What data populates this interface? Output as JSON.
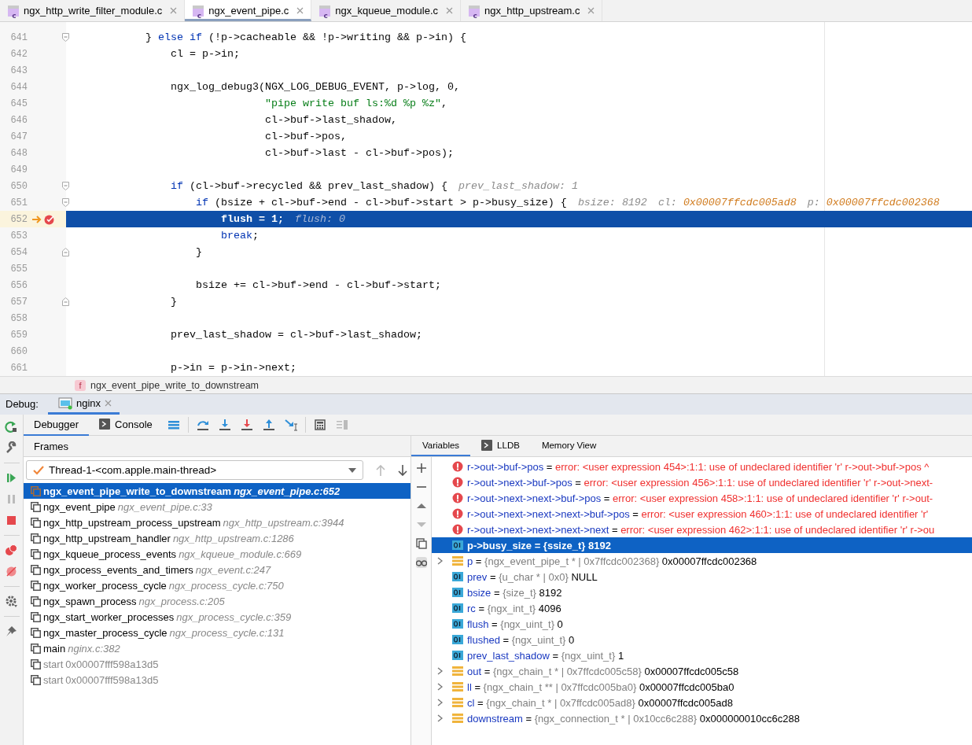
{
  "editor_tabs": [
    {
      "label": "ngx_http_write_filter_module.c",
      "file_type": "c",
      "selected": false
    },
    {
      "label": "ngx_event_pipe.c",
      "file_type": "c",
      "selected": true
    },
    {
      "label": "ngx_kqueue_module.c",
      "file_type": "c",
      "selected": false
    },
    {
      "label": "ngx_http_upstream.c",
      "file_type": "c",
      "selected": false
    }
  ],
  "editor": {
    "lines": [
      {
        "number": "641",
        "fold_open": true,
        "tokens": [
          {
            "kind": "plain",
            "text": "            } "
          },
          {
            "kind": "keyword",
            "text": "else"
          },
          {
            "kind": "keyword",
            "text": " if"
          },
          {
            "kind": "plain",
            "text": " (!p->cacheable && !p->writing && p->in) {"
          }
        ]
      },
      {
        "number": "642",
        "tokens": [
          {
            "kind": "plain",
            "text": "                cl = p->in;"
          }
        ]
      },
      {
        "number": "643"
      },
      {
        "number": "644",
        "tokens": [
          {
            "kind": "plain",
            "text": "                ngx_log_debug3(NGX_LOG_DEBUG_EVENT, p->log, 0,"
          }
        ]
      },
      {
        "number": "645",
        "tokens": [
          {
            "kind": "string",
            "text": "                               \"pipe write buf ls:%d %p %z\""
          },
          {
            "kind": "plain",
            "text": ","
          }
        ]
      },
      {
        "number": "646",
        "tokens": [
          {
            "kind": "plain",
            "text": "                               cl->buf->last_shadow,"
          }
        ]
      },
      {
        "number": "647",
        "tokens": [
          {
            "kind": "plain",
            "text": "                               cl->buf->pos,"
          }
        ]
      },
      {
        "number": "648",
        "tokens": [
          {
            "kind": "plain",
            "text": "                               cl->buf->last - cl->buf->pos);"
          }
        ]
      },
      {
        "number": "649"
      },
      {
        "number": "650",
        "fold_open": true,
        "tokens": [
          {
            "kind": "keyword",
            "text": "                if"
          },
          {
            "kind": "plain",
            "text": " (cl->buf->recycled && prev_last_shadow) {"
          }
        ],
        "hints": [
          {
            "label": "prev_last_shadow:",
            "value": "1",
            "kind": "number"
          }
        ]
      },
      {
        "number": "651",
        "fold_open": true,
        "tokens": [
          {
            "kind": "keyword",
            "text": "                    if"
          },
          {
            "kind": "plain",
            "text": " (bsize + cl->buf->end - cl->buf->start > p->busy_size) {"
          }
        ],
        "hints": [
          {
            "label": "bsize:",
            "value": "8192",
            "kind": "number"
          },
          {
            "label": "cl:",
            "value": "0x00007ffcdc005ad8",
            "kind": "address"
          },
          {
            "label": "p:",
            "value": "0x00007ffcdc002368",
            "kind": "address"
          }
        ]
      },
      {
        "number": "652",
        "current": true,
        "breakpoint": true,
        "tokens": [
          {
            "kind": "plain",
            "text": "                        flush = 1;"
          }
        ],
        "hints": [
          {
            "label": "flush:",
            "value": "0",
            "kind": "number"
          }
        ]
      },
      {
        "number": "653",
        "tokens": [
          {
            "kind": "keyword",
            "text": "                        break"
          },
          {
            "kind": "plain",
            "text": ";"
          }
        ]
      },
      {
        "number": "654",
        "fold_close": true,
        "tokens": [
          {
            "kind": "plain",
            "text": "                    }"
          }
        ]
      },
      {
        "number": "655"
      },
      {
        "number": "656",
        "tokens": [
          {
            "kind": "plain",
            "text": "                    bsize += cl->buf->end - cl->buf->start;"
          }
        ]
      },
      {
        "number": "657",
        "fold_close": true,
        "tokens": [
          {
            "kind": "plain",
            "text": "                }"
          }
        ]
      },
      {
        "number": "658"
      },
      {
        "number": "659",
        "tokens": [
          {
            "kind": "plain",
            "text": "                prev_last_shadow = cl->buf->last_shadow;"
          }
        ]
      },
      {
        "number": "660"
      },
      {
        "number": "661",
        "tokens": [
          {
            "kind": "plain",
            "text": "                p->in = p->in->next;"
          }
        ]
      }
    ]
  },
  "breadcrumb": {
    "badge": "f",
    "label": "ngx_event_pipe_write_to_downstream"
  },
  "debug": {
    "label": "Debug:",
    "session_tabs": [
      {
        "label": "nginx",
        "selected": true
      }
    ],
    "tabs": [
      {
        "label": "Debugger",
        "selected": true
      },
      {
        "label": "Console",
        "selected": false
      }
    ],
    "frames": {
      "title": "Frames",
      "thread": "Thread-1-<com.apple.main-thread>",
      "items": [
        {
          "kind": "source",
          "function": "ngx_event_pipe_write_to_downstream",
          "location": "ngx_event_pipe.c:652",
          "selected": true
        },
        {
          "kind": "source",
          "function": "ngx_event_pipe",
          "location": "ngx_event_pipe.c:33",
          "selected": false
        },
        {
          "kind": "source",
          "function": "ngx_http_upstream_process_upstream",
          "location": "ngx_http_upstream.c:3944",
          "selected": false
        },
        {
          "kind": "source",
          "function": "ngx_http_upstream_handler",
          "location": "ngx_http_upstream.c:1286",
          "selected": false
        },
        {
          "kind": "source",
          "function": "ngx_kqueue_process_events",
          "location": "ngx_kqueue_module.c:669",
          "selected": false
        },
        {
          "kind": "source",
          "function": "ngx_process_events_and_timers",
          "location": "ngx_event.c:247",
          "selected": false
        },
        {
          "kind": "source",
          "function": "ngx_worker_process_cycle",
          "location": "ngx_process_cycle.c:750",
          "selected": false
        },
        {
          "kind": "source",
          "function": "ngx_spawn_process",
          "location": "ngx_process.c:205",
          "selected": false
        },
        {
          "kind": "source",
          "function": "ngx_start_worker_processes",
          "location": "ngx_process_cycle.c:359",
          "selected": false
        },
        {
          "kind": "source",
          "function": "ngx_master_process_cycle",
          "location": "ngx_process_cycle.c:131",
          "selected": false
        },
        {
          "kind": "source",
          "function": "main",
          "location": "nginx.c:382",
          "selected": false
        },
        {
          "kind": "address",
          "function": "start",
          "location": "0x00007fff598a13d5",
          "selected": false
        },
        {
          "kind": "address",
          "function": "start",
          "location": "0x00007fff598a13d5",
          "selected": false
        }
      ]
    },
    "variables": {
      "tabs": [
        {
          "label": "Variables",
          "selected": true
        },
        {
          "label": "LLDB",
          "selected": false
        },
        {
          "label": "Memory View",
          "selected": false
        }
      ],
      "items": [
        {
          "kind": "error",
          "name": "r->out->buf->pos",
          "operator": "=",
          "value": "error: <user expression 454>:1:1: use of undeclared identifier 'r' r->out->buf->pos ^",
          "selected": false
        },
        {
          "kind": "error",
          "name": "r->out->next->buf->pos",
          "operator": "=",
          "value": "error: <user expression 456>:1:1: use of undeclared identifier 'r' r->out->next-",
          "selected": false
        },
        {
          "kind": "error",
          "name": "r->out->next->next->buf->pos",
          "operator": "=",
          "value": "error: <user expression 458>:1:1: use of undeclared identifier 'r' r->out-",
          "selected": false
        },
        {
          "kind": "error",
          "name": "r->out->next->next->next->buf->pos",
          "operator": "=",
          "value": "error: <user expression 460>:1:1: use of undeclared identifier 'r'",
          "selected": false
        },
        {
          "kind": "error",
          "name": "r->out->next->next->next->next",
          "operator": "=",
          "value": "error: <user expression 462>:1:1: use of undeclared identifier 'r' r->ou",
          "selected": false
        },
        {
          "kind": "primitive",
          "name": "p->busy_size",
          "operator": "=",
          "type": "{ssize_t}",
          "value": "8192",
          "selected": true
        },
        {
          "kind": "struct",
          "name": "p",
          "operator": "=",
          "type": "{ngx_event_pipe_t * | 0x7ffcdc002368}",
          "value": "0x00007ffcdc002368",
          "expanded": false,
          "selected": false
        },
        {
          "kind": "primitive",
          "name": "prev",
          "operator": "=",
          "type": "{u_char * | 0x0}",
          "value": "NULL",
          "selected": false
        },
        {
          "kind": "primitive",
          "name": "bsize",
          "operator": "=",
          "type": "{size_t}",
          "value": "8192",
          "selected": false
        },
        {
          "kind": "primitive",
          "name": "rc",
          "operator": "=",
          "type": "{ngx_int_t}",
          "value": "4096",
          "selected": false
        },
        {
          "kind": "primitive",
          "name": "flush",
          "operator": "=",
          "type": "{ngx_uint_t}",
          "value": "0",
          "selected": false
        },
        {
          "kind": "primitive",
          "name": "flushed",
          "operator": "=",
          "type": "{ngx_uint_t}",
          "value": "0",
          "selected": false
        },
        {
          "kind": "primitive",
          "name": "prev_last_shadow",
          "operator": "=",
          "type": "{ngx_uint_t}",
          "value": "1",
          "selected": false
        },
        {
          "kind": "struct",
          "name": "out",
          "operator": "=",
          "type": "{ngx_chain_t * | 0x7ffcdc005c58}",
          "value": "0x00007ffcdc005c58",
          "expanded": false,
          "selected": false
        },
        {
          "kind": "struct",
          "name": "ll",
          "operator": "=",
          "type": "{ngx_chain_t ** | 0x7ffcdc005ba0}",
          "value": "0x00007ffcdc005ba0",
          "expanded": false,
          "selected": false
        },
        {
          "kind": "struct",
          "name": "cl",
          "operator": "=",
          "type": "{ngx_chain_t * | 0x7ffcdc005ad8}",
          "value": "0x00007ffcdc005ad8",
          "expanded": false,
          "selected": false
        },
        {
          "kind": "struct",
          "name": "downstream",
          "operator": "=",
          "type": "{ngx_connection_t * | 0x10cc6c288}",
          "value": "0x000000010cc6c288",
          "expanded": false,
          "selected": false
        }
      ]
    }
  }
}
